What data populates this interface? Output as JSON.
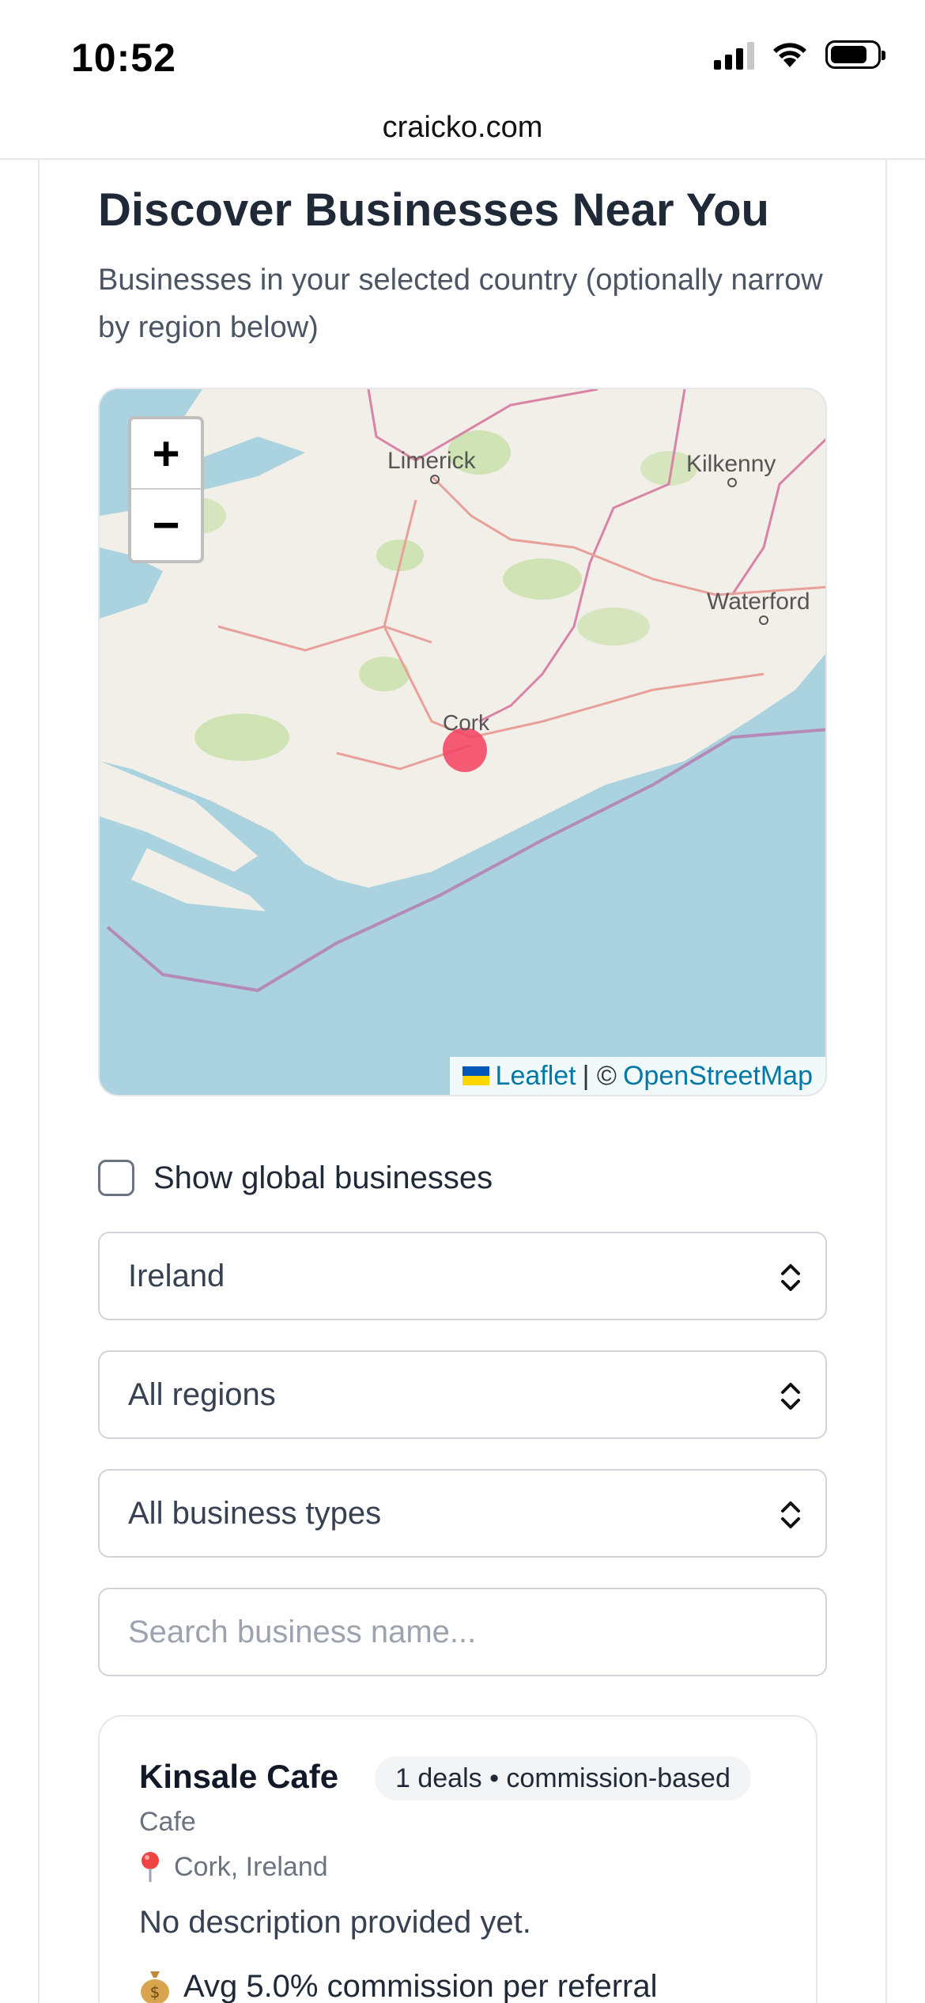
{
  "status_bar": {
    "time": "10:52"
  },
  "browser": {
    "url": "craicko.com"
  },
  "page": {
    "title": "Discover Businesses Near You",
    "subtitle": "Businesses in your selected country (optionally narrow by region below)"
  },
  "map": {
    "zoom_in_label": "+",
    "zoom_out_label": "−",
    "places": {
      "limerick": "Limerick",
      "kilkenny": "Kilkenny",
      "waterford": "Waterford",
      "cork": "Cork"
    },
    "attribution": {
      "leaflet": "Leaflet",
      "separator": "| ©",
      "osm": "OpenStreetMap"
    },
    "marker_color": "#f43f5e",
    "water_color": "#aad3df",
    "land_color": "#f2efe9"
  },
  "filters": {
    "global_label": "Show global businesses",
    "global_checked": false,
    "country": "Ireland",
    "region": "All regions",
    "business_type": "All business types",
    "search_placeholder": "Search business name..."
  },
  "businesses": [
    {
      "name": "Kinsale Cafe",
      "badge": "1 deals • commission-based",
      "type": "Cafe",
      "location": "Cork, Ireland",
      "description": "No description provided yet.",
      "commission": "Avg 5.0% commission per referral"
    }
  ]
}
